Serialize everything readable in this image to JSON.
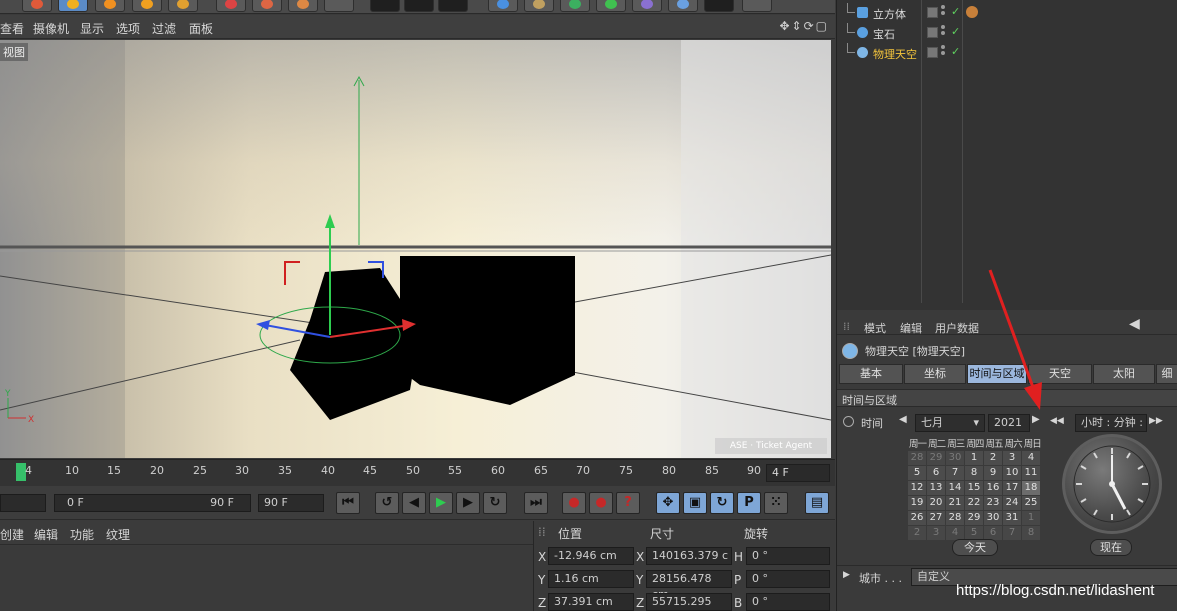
{
  "viewport_menu": [
    "查看",
    "摄像机",
    "显示",
    "选项",
    "过滤",
    "面板"
  ],
  "viewport_label": "视图",
  "watermark": "ASE · Ticket Agent",
  "timeline": {
    "ticks": [
      "4",
      "10",
      "15",
      "20",
      "25",
      "30",
      "35",
      "40",
      "45",
      "50",
      "55",
      "60",
      "65",
      "70",
      "75",
      "80",
      "85",
      "90"
    ],
    "current_frame": "4 F"
  },
  "transport": {
    "field_a": "0 F",
    "field_b": "90 F",
    "field_c": "90 F"
  },
  "object_menu": [
    "创建",
    "编辑",
    "功能",
    "纹理"
  ],
  "coords": {
    "headers": [
      "位置",
      "尺寸",
      "旋转"
    ],
    "rows": [
      {
        "axis": "X",
        "pos": "-12.946 cm",
        "size_axis": "X",
        "size": "140163.379 c",
        "rot_axis": "H",
        "rot": "0 °"
      },
      {
        "axis": "Y",
        "pos": "1.16 cm",
        "size_axis": "Y",
        "size": "28156.478 cm",
        "rot_axis": "P",
        "rot": "0 °"
      },
      {
        "axis": "Z",
        "pos": "37.391 cm",
        "size_axis": "Z",
        "size": "55715.295 cm",
        "rot_axis": "B",
        "rot": "0 °"
      }
    ]
  },
  "objects": [
    {
      "name": "立方体",
      "color": "#5aa0e0",
      "highlight": false
    },
    {
      "name": "宝石",
      "color": "#5aa0e0",
      "highlight": false
    },
    {
      "name": "物理天空",
      "color": "#7fb6e6",
      "highlight": true
    }
  ],
  "attr": {
    "menu": [
      "模式",
      "编辑",
      "用户数据"
    ],
    "title": "物理天空 [物理天空]",
    "tabs": [
      "基本",
      "坐标",
      "时间与区域",
      "天空",
      "太阳",
      "细"
    ],
    "active_tab_index": 2,
    "section": "时间与区域",
    "time_label": "时间",
    "month": "七月",
    "year": "2021",
    "time_field_placeholder": "小时 : 分钟 :",
    "weekdays": [
      "周一",
      "周二",
      "周三",
      "周四",
      "周五",
      "周六",
      "周日"
    ],
    "days": [
      [
        "28",
        "29",
        "30",
        "1",
        "2",
        "3",
        "4"
      ],
      [
        "5",
        "6",
        "7",
        "8",
        "9",
        "10",
        "11"
      ],
      [
        "12",
        "13",
        "14",
        "15",
        "16",
        "17",
        "18"
      ],
      [
        "19",
        "20",
        "21",
        "22",
        "23",
        "24",
        "25"
      ],
      [
        "26",
        "27",
        "28",
        "29",
        "30",
        "31",
        "1"
      ],
      [
        "2",
        "3",
        "4",
        "5",
        "6",
        "7",
        "8"
      ]
    ],
    "today_button": "今天",
    "now_button": "现在",
    "city_label": "城市 . . .",
    "city_value": "自定义"
  },
  "footer_url": "https://blog.csdn.net/lidashent"
}
